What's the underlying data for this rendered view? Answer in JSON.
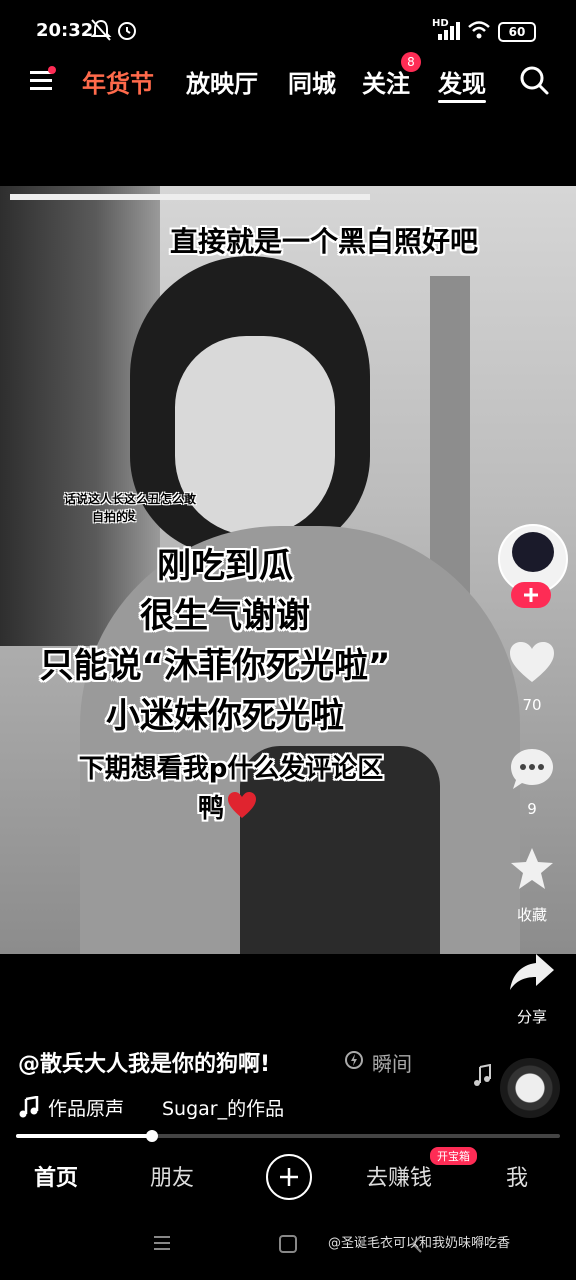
{
  "status": {
    "time": "20:32",
    "battery": "60",
    "network": "HD"
  },
  "top_nav": {
    "items": [
      {
        "label": "年货节"
      },
      {
        "label": "放映厅"
      },
      {
        "label": "同城"
      },
      {
        "label": "关注",
        "badge": "8"
      },
      {
        "label": "发现"
      }
    ]
  },
  "video": {
    "captions": {
      "top": "直接就是一个黑白照好吧",
      "small_line1": "话说这人长这么丑怎么敢发",
      "small_line2": "自拍的",
      "big_1": "刚吃到瓜",
      "big_2": "很生气谢谢",
      "big_3": "只能说“沐菲你死光啦”",
      "big_4": "小迷妹你死光啦",
      "med_1": "下期想看我p什么发评论区",
      "med_2": "鸭"
    }
  },
  "rail": {
    "likes": "70",
    "comments": "9",
    "favorite_label": "收藏",
    "share_label": "分享"
  },
  "info": {
    "author": "@散兵大人我是你的狗啊!",
    "flash_label": "瞬间",
    "music_label": "作品原声",
    "music_owner": "Sugar_的作品",
    "progress": 0.25
  },
  "bottom_tabs": {
    "home": "首页",
    "friends": "朋友",
    "earn": "去赚钱",
    "earn_badge": "开宝箱",
    "me": "我"
  },
  "watermark": "@圣诞毛衣可以和我奶味嘚吃香",
  "colors": {
    "accent": "#fe2c55",
    "festival": "#ff6a4b"
  }
}
